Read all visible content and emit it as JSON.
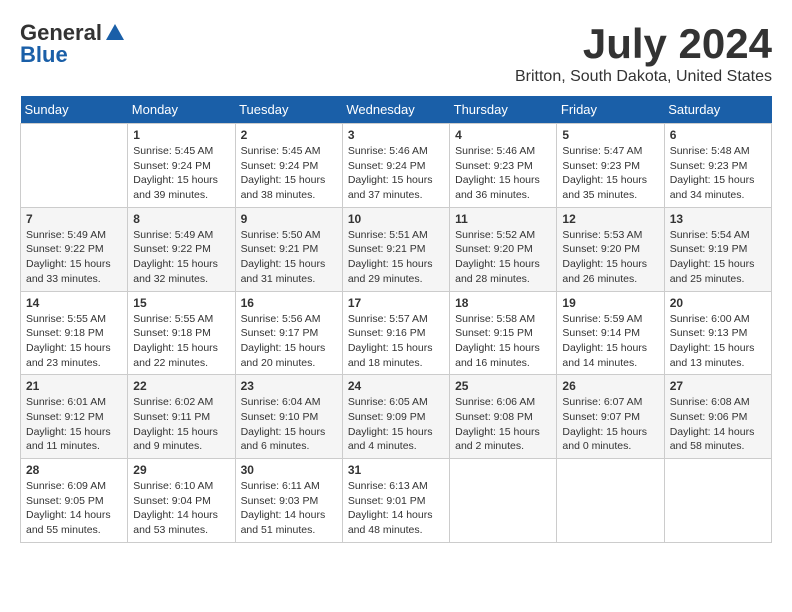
{
  "logo": {
    "general": "General",
    "blue": "Blue"
  },
  "title": "July 2024",
  "location": "Britton, South Dakota, United States",
  "days_of_week": [
    "Sunday",
    "Monday",
    "Tuesday",
    "Wednesday",
    "Thursday",
    "Friday",
    "Saturday"
  ],
  "weeks": [
    [
      {
        "day": "",
        "info": ""
      },
      {
        "day": "1",
        "info": "Sunrise: 5:45 AM\nSunset: 9:24 PM\nDaylight: 15 hours\nand 39 minutes."
      },
      {
        "day": "2",
        "info": "Sunrise: 5:45 AM\nSunset: 9:24 PM\nDaylight: 15 hours\nand 38 minutes."
      },
      {
        "day": "3",
        "info": "Sunrise: 5:46 AM\nSunset: 9:24 PM\nDaylight: 15 hours\nand 37 minutes."
      },
      {
        "day": "4",
        "info": "Sunrise: 5:46 AM\nSunset: 9:23 PM\nDaylight: 15 hours\nand 36 minutes."
      },
      {
        "day": "5",
        "info": "Sunrise: 5:47 AM\nSunset: 9:23 PM\nDaylight: 15 hours\nand 35 minutes."
      },
      {
        "day": "6",
        "info": "Sunrise: 5:48 AM\nSunset: 9:23 PM\nDaylight: 15 hours\nand 34 minutes."
      }
    ],
    [
      {
        "day": "7",
        "info": "Sunrise: 5:49 AM\nSunset: 9:22 PM\nDaylight: 15 hours\nand 33 minutes."
      },
      {
        "day": "8",
        "info": "Sunrise: 5:49 AM\nSunset: 9:22 PM\nDaylight: 15 hours\nand 32 minutes."
      },
      {
        "day": "9",
        "info": "Sunrise: 5:50 AM\nSunset: 9:21 PM\nDaylight: 15 hours\nand 31 minutes."
      },
      {
        "day": "10",
        "info": "Sunrise: 5:51 AM\nSunset: 9:21 PM\nDaylight: 15 hours\nand 29 minutes."
      },
      {
        "day": "11",
        "info": "Sunrise: 5:52 AM\nSunset: 9:20 PM\nDaylight: 15 hours\nand 28 minutes."
      },
      {
        "day": "12",
        "info": "Sunrise: 5:53 AM\nSunset: 9:20 PM\nDaylight: 15 hours\nand 26 minutes."
      },
      {
        "day": "13",
        "info": "Sunrise: 5:54 AM\nSunset: 9:19 PM\nDaylight: 15 hours\nand 25 minutes."
      }
    ],
    [
      {
        "day": "14",
        "info": "Sunrise: 5:55 AM\nSunset: 9:18 PM\nDaylight: 15 hours\nand 23 minutes."
      },
      {
        "day": "15",
        "info": "Sunrise: 5:55 AM\nSunset: 9:18 PM\nDaylight: 15 hours\nand 22 minutes."
      },
      {
        "day": "16",
        "info": "Sunrise: 5:56 AM\nSunset: 9:17 PM\nDaylight: 15 hours\nand 20 minutes."
      },
      {
        "day": "17",
        "info": "Sunrise: 5:57 AM\nSunset: 9:16 PM\nDaylight: 15 hours\nand 18 minutes."
      },
      {
        "day": "18",
        "info": "Sunrise: 5:58 AM\nSunset: 9:15 PM\nDaylight: 15 hours\nand 16 minutes."
      },
      {
        "day": "19",
        "info": "Sunrise: 5:59 AM\nSunset: 9:14 PM\nDaylight: 15 hours\nand 14 minutes."
      },
      {
        "day": "20",
        "info": "Sunrise: 6:00 AM\nSunset: 9:13 PM\nDaylight: 15 hours\nand 13 minutes."
      }
    ],
    [
      {
        "day": "21",
        "info": "Sunrise: 6:01 AM\nSunset: 9:12 PM\nDaylight: 15 hours\nand 11 minutes."
      },
      {
        "day": "22",
        "info": "Sunrise: 6:02 AM\nSunset: 9:11 PM\nDaylight: 15 hours\nand 9 minutes."
      },
      {
        "day": "23",
        "info": "Sunrise: 6:04 AM\nSunset: 9:10 PM\nDaylight: 15 hours\nand 6 minutes."
      },
      {
        "day": "24",
        "info": "Sunrise: 6:05 AM\nSunset: 9:09 PM\nDaylight: 15 hours\nand 4 minutes."
      },
      {
        "day": "25",
        "info": "Sunrise: 6:06 AM\nSunset: 9:08 PM\nDaylight: 15 hours\nand 2 minutes."
      },
      {
        "day": "26",
        "info": "Sunrise: 6:07 AM\nSunset: 9:07 PM\nDaylight: 15 hours\nand 0 minutes."
      },
      {
        "day": "27",
        "info": "Sunrise: 6:08 AM\nSunset: 9:06 PM\nDaylight: 14 hours\nand 58 minutes."
      }
    ],
    [
      {
        "day": "28",
        "info": "Sunrise: 6:09 AM\nSunset: 9:05 PM\nDaylight: 14 hours\nand 55 minutes."
      },
      {
        "day": "29",
        "info": "Sunrise: 6:10 AM\nSunset: 9:04 PM\nDaylight: 14 hours\nand 53 minutes."
      },
      {
        "day": "30",
        "info": "Sunrise: 6:11 AM\nSunset: 9:03 PM\nDaylight: 14 hours\nand 51 minutes."
      },
      {
        "day": "31",
        "info": "Sunrise: 6:13 AM\nSunset: 9:01 PM\nDaylight: 14 hours\nand 48 minutes."
      },
      {
        "day": "",
        "info": ""
      },
      {
        "day": "",
        "info": ""
      },
      {
        "day": "",
        "info": ""
      }
    ]
  ]
}
